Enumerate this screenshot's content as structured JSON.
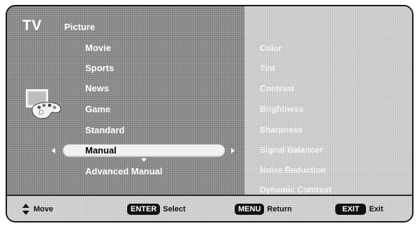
{
  "header": {
    "app_label": "TV",
    "section_title": "Picture"
  },
  "picture_modes": {
    "items": [
      "Movie",
      "Sports",
      "News",
      "Game",
      "Standard",
      "Manual",
      "Advanced Manual"
    ],
    "selected": "Manual"
  },
  "picture_settings": {
    "items": [
      "Color",
      "Tint",
      "Contrast",
      "Brightness",
      "Sharpness",
      "Signal Balancer",
      "Noise Reduction",
      "Dynamic Contrast"
    ]
  },
  "footer": {
    "move_label": "Move",
    "enter_key": "ENTER",
    "select_label": "Select",
    "menu_key": "MENU",
    "return_label": "Return",
    "exit_key": "EXIT",
    "exit_label": "Exit"
  },
  "icons": {
    "palette": "palette-icon",
    "move": "up-down-arrow-icon",
    "scroll_left": "chevron-left-icon",
    "scroll_right": "chevron-right-icon",
    "scroll_down": "chevron-down-icon"
  },
  "colors": {
    "menu_background": "#8c8c8c",
    "settings_background": "#cdcdcd",
    "selection_bar": "#f2f2f2",
    "footer_background": "#d6d6d6"
  }
}
